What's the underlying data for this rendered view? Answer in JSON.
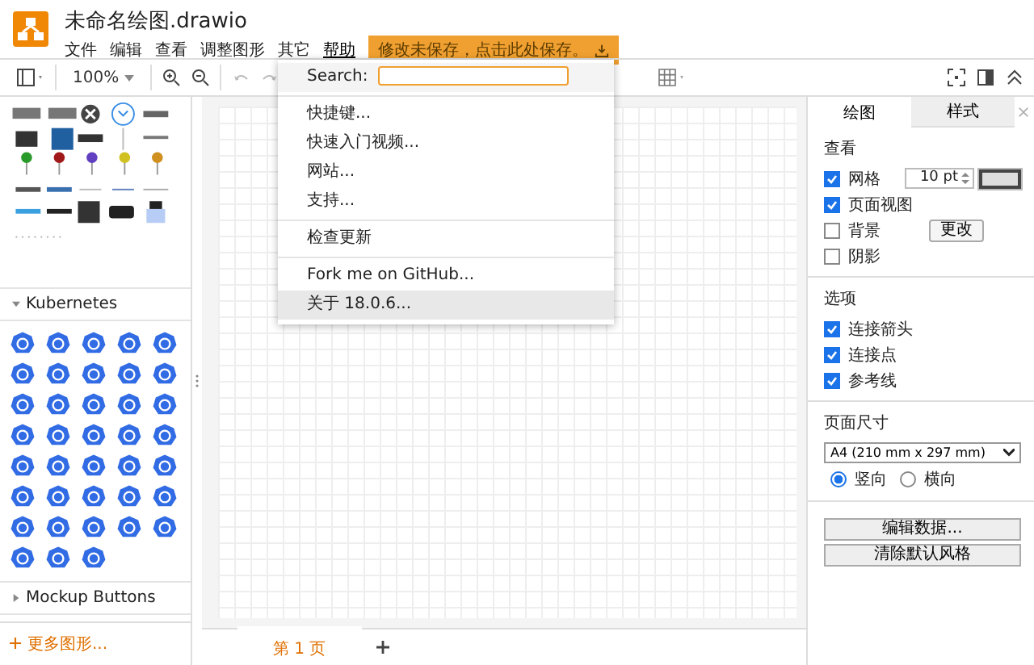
{
  "window": {
    "title": "未命名绘图.drawio"
  },
  "menu": [
    {
      "label": "文件",
      "selected": false
    },
    {
      "label": "编辑",
      "selected": false
    },
    {
      "label": "查看",
      "selected": false
    },
    {
      "label": "调整图形",
      "selected": false
    },
    {
      "label": "其它",
      "selected": false
    },
    {
      "label": "帮助",
      "selected": true
    }
  ],
  "save_notice": "修改未保存，点击此处保存。",
  "toolbar": {
    "zoom": "100%"
  },
  "help_menu": {
    "search_label": "Search:",
    "groups": [
      [
        {
          "label": "快捷键...",
          "highlighted": false
        },
        {
          "label": "快速入门视频...",
          "highlighted": false
        },
        {
          "label": "网站...",
          "highlighted": false
        },
        {
          "label": "支持...",
          "highlighted": false
        }
      ],
      [
        {
          "label": "检查更新",
          "highlighted": false
        }
      ],
      [
        {
          "label": "Fork me on GitHub...",
          "highlighted": false
        },
        {
          "label": "关于 18.0.6...",
          "highlighted": true
        }
      ]
    ]
  },
  "sidebar": {
    "sections": [
      {
        "title": "Kubernetes",
        "expanded": true
      },
      {
        "title": "Mockup Buttons",
        "expanded": false
      }
    ],
    "more_shapes": "更多图形..."
  },
  "pages": [
    {
      "label": "第 1 页",
      "selected": true
    }
  ],
  "format_panel": {
    "tabs": [
      {
        "label": "绘图",
        "selected": true
      },
      {
        "label": "样式",
        "selected": false
      }
    ],
    "view": {
      "title": "查看",
      "options": [
        {
          "label": "网格",
          "checked": true
        },
        {
          "label": "页面视图",
          "checked": true
        },
        {
          "label": "背景",
          "checked": false
        },
        {
          "label": "阴影",
          "checked": false
        }
      ],
      "grid_size": "10 pt",
      "change_button": "更改"
    },
    "options": {
      "title": "选项",
      "options": [
        {
          "label": "连接箭头",
          "checked": true
        },
        {
          "label": "连接点",
          "checked": true
        },
        {
          "label": "参考线",
          "checked": true
        }
      ]
    },
    "page_size": {
      "title": "页面尺寸",
      "value": "A4 (210 mm x 297 mm)",
      "orientations": [
        {
          "label": "竖向",
          "selected": true
        },
        {
          "label": "横向",
          "selected": false
        }
      ]
    },
    "buttons": [
      "编辑数据...",
      "清除默认风格"
    ]
  }
}
